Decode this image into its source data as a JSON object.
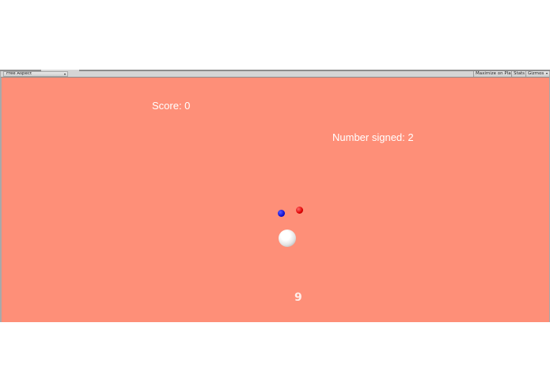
{
  "toolbar": {
    "aspect_label": "Free Aspect",
    "aspect_caret": "▾",
    "maximize_label": "Maximize on Play",
    "stats_label": "Stats",
    "gizmos_label": "Gizmos",
    "gizmos_caret": "▾"
  },
  "game": {
    "background_color": "#fe8f78",
    "score_text": "Score: 0",
    "number_signed_text": "Number signed: 2",
    "center_glyph": "9",
    "balls": [
      {
        "name": "blue",
        "color": "#1010d0"
      },
      {
        "name": "red",
        "color": "#e00000"
      },
      {
        "name": "white",
        "color": "#ffffff"
      }
    ]
  }
}
